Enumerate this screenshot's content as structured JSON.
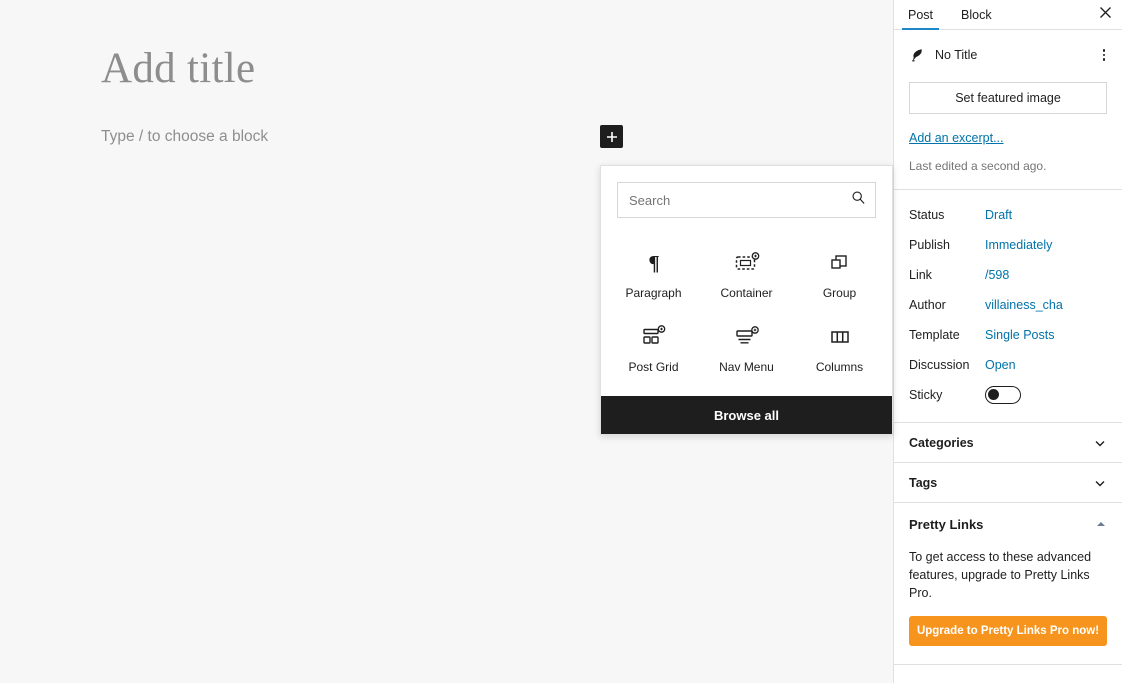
{
  "canvas": {
    "title_placeholder": "Add title",
    "paragraph_placeholder": "Type / to choose a block",
    "inserter_icon": "plus-icon"
  },
  "inserter": {
    "search_placeholder": "Search",
    "search_value": "",
    "search_icon": "search-icon",
    "blocks": [
      {
        "label": "Paragraph",
        "icon": "paragraph-pilcrow-icon"
      },
      {
        "label": "Container",
        "icon": "container-icon"
      },
      {
        "label": "Group",
        "icon": "group-icon"
      },
      {
        "label": "Post Grid",
        "icon": "post-grid-icon"
      },
      {
        "label": "Nav Menu",
        "icon": "nav-menu-icon"
      },
      {
        "label": "Columns",
        "icon": "columns-icon"
      }
    ],
    "browse_all_label": "Browse all"
  },
  "sidebar": {
    "tabs": [
      {
        "label": "Post",
        "active": true
      },
      {
        "label": "Block",
        "active": false
      }
    ],
    "close_icon": "close-icon",
    "document": {
      "icon": "quill-pen-icon",
      "title": "No Title",
      "menu_icon": "ellipsis-vertical-icon",
      "featured_image_label": "Set featured image",
      "excerpt_link": "Add an excerpt...",
      "last_edited": "Last edited a second ago."
    },
    "meta": [
      {
        "key": "Status",
        "value": "Draft",
        "type": "link"
      },
      {
        "key": "Publish",
        "value": "Immediately",
        "type": "link"
      },
      {
        "key": "Link",
        "value": "/598",
        "type": "link"
      },
      {
        "key": "Author",
        "value": "villainess_cha",
        "type": "link"
      },
      {
        "key": "Template",
        "value": "Single Posts",
        "type": "link"
      },
      {
        "key": "Discussion",
        "value": "Open",
        "type": "link"
      },
      {
        "key": "Sticky",
        "value": "",
        "type": "toggle",
        "toggle_on": false
      }
    ],
    "panels": [
      {
        "title": "Categories",
        "icon": "chevron-down-icon"
      },
      {
        "title": "Tags",
        "icon": "chevron-down-icon"
      }
    ],
    "pretty_links": {
      "title": "Pretty Links",
      "collapse_icon": "chevron-up-icon",
      "body": "To get access to these advanced features, upgrade to Pretty Links Pro.",
      "cta_label": "Upgrade to Pretty Links Pro now!",
      "cta_color": "#f7941d"
    }
  },
  "colors": {
    "accent": "#0073aa",
    "tab_underline": "#1e87c8",
    "dark": "#1e1e1e",
    "canvas_bg": "#f7f7f7"
  }
}
